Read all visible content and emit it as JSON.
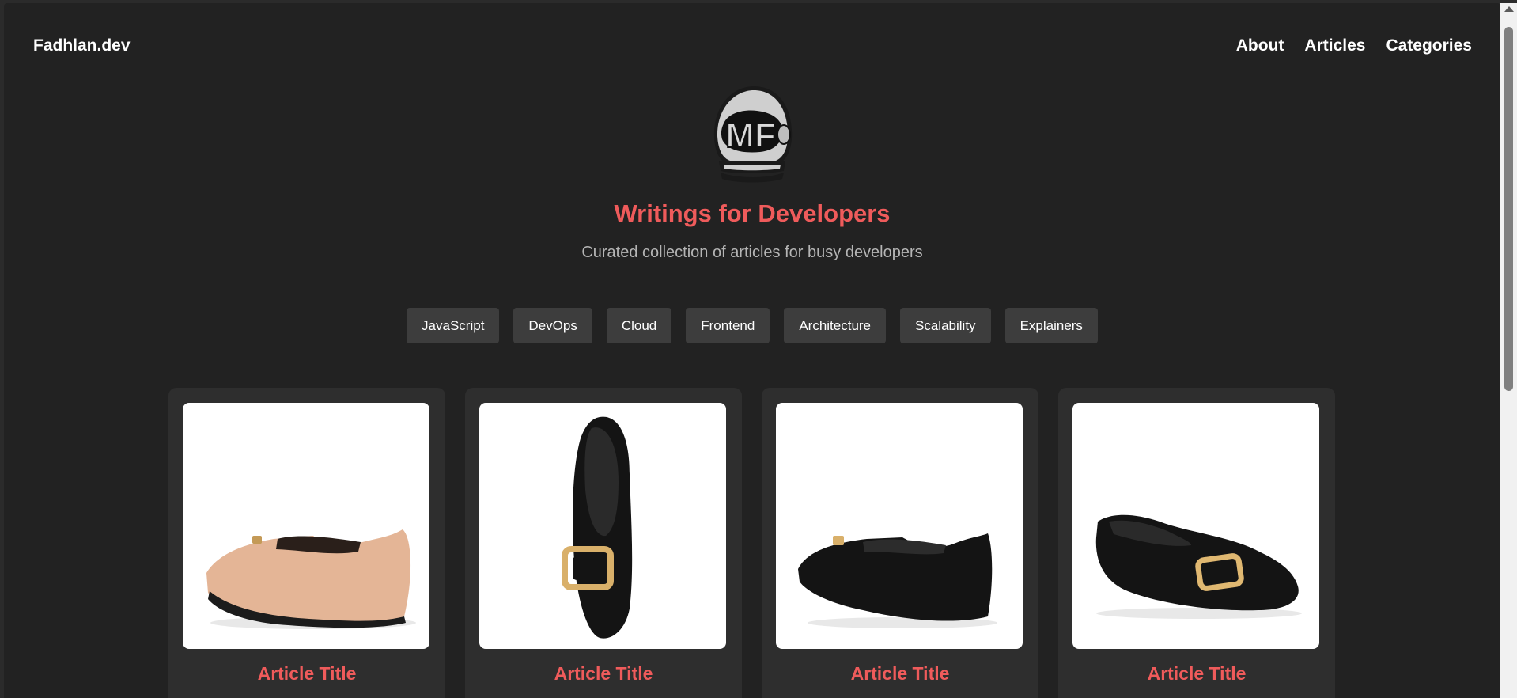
{
  "header": {
    "brand": "Fadhlan.dev",
    "nav": [
      {
        "label": "About"
      },
      {
        "label": "Articles"
      },
      {
        "label": "Categories"
      }
    ]
  },
  "hero": {
    "logo_text": "MF",
    "title": "Writings for Developers",
    "subtitle": "Curated collection of articles for busy developers"
  },
  "tags": [
    {
      "label": "JavaScript"
    },
    {
      "label": "DevOps"
    },
    {
      "label": "Cloud"
    },
    {
      "label": "Frontend"
    },
    {
      "label": "Architecture"
    },
    {
      "label": "Scalability"
    },
    {
      "label": "Explainers"
    }
  ],
  "articles": [
    {
      "title": "Article Title",
      "image": "beige-flat-shoe-side-view"
    },
    {
      "title": "Article Title",
      "image": "black-flat-shoe-top-view"
    },
    {
      "title": "Article Title",
      "image": "black-flat-shoe-side-view"
    },
    {
      "title": "Article Title",
      "image": "black-flat-shoe-front-view"
    }
  ],
  "colors": {
    "accent": "#ef5b5b",
    "background": "#222222",
    "tag_bg": "#3d3d3d",
    "card_bg": "#2e2e2e"
  }
}
